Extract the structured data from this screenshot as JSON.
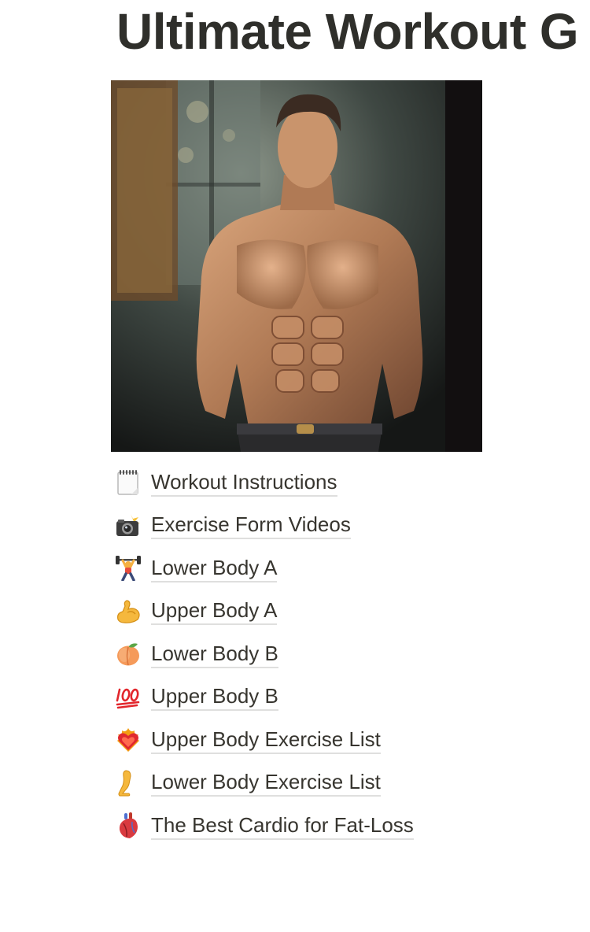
{
  "page": {
    "title": "Ultimate Workout G"
  },
  "cover": {
    "icon": "muscular-man-image"
  },
  "links": [
    {
      "icon": "notepad-icon",
      "label": "Workout Instructions"
    },
    {
      "icon": "camera-flash-icon",
      "label": "Exercise Form Videos"
    },
    {
      "icon": "weightlifter-icon",
      "label": "Lower Body A"
    },
    {
      "icon": "flexed-biceps-icon",
      "label": "Upper Body A"
    },
    {
      "icon": "peach-icon",
      "label": "Lower Body B"
    },
    {
      "icon": "hundred-points-icon",
      "label": "Upper Body B"
    },
    {
      "icon": "heart-on-fire-icon",
      "label": "Upper Body Exercise List"
    },
    {
      "icon": "leg-icon",
      "label": "Lower Body Exercise List"
    },
    {
      "icon": "anatomical-heart-icon",
      "label": "The Best Cardio for Fat-Loss"
    }
  ],
  "colors": {
    "text": "#37352f",
    "underline": "rgba(55,53,47,0.16)",
    "background": "#ffffff"
  }
}
